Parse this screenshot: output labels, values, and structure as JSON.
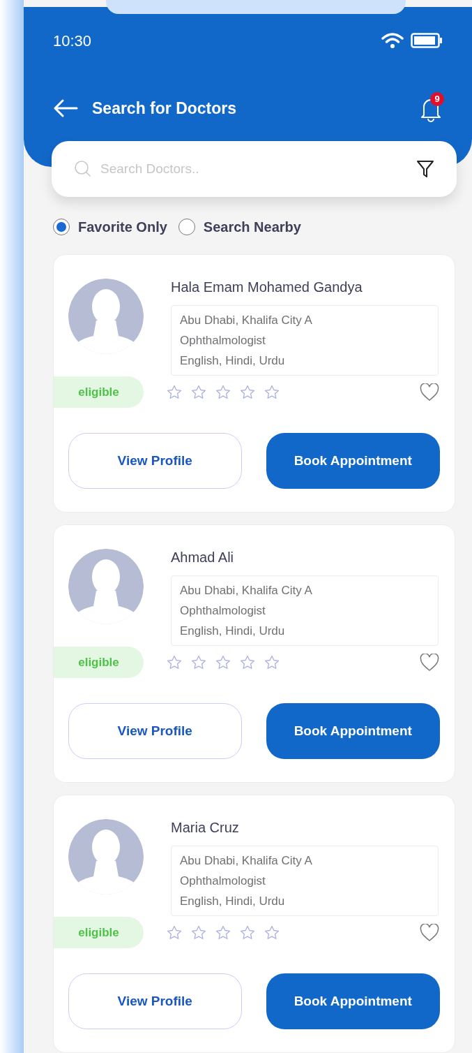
{
  "status_bar": {
    "time": "10:30"
  },
  "header": {
    "title": "Search for Doctors",
    "notification_count": "9"
  },
  "search": {
    "placeholder": "Search Doctors.."
  },
  "filters": [
    {
      "label": "Favorite Only",
      "selected": true
    },
    {
      "label": "Search Nearby",
      "selected": false
    }
  ],
  "doctors": [
    {
      "name": "Hala Emam Mohamed Gandya",
      "location": "Abu Dhabi, Khalifa City A",
      "specialty": "Ophthalmologist",
      "languages": "English, Hindi, Urdu",
      "badge": "eligible",
      "stars": 0,
      "favorite": false,
      "actions": [
        "View Profile",
        "Book Appointment"
      ]
    },
    {
      "name": "Ahmad Ali",
      "location": "Abu Dhabi, Khalifa City A",
      "specialty": "Ophthalmologist",
      "languages": "English, Hindi, Urdu",
      "badge": "eligible",
      "stars": 0,
      "favorite": false,
      "actions": [
        "View Profile",
        "Book Appointment"
      ]
    },
    {
      "name": "Maria Cruz",
      "location": "Abu Dhabi, Khalifa City A",
      "specialty": "Ophthalmologist",
      "languages": "English, Hindi, Urdu",
      "badge": "eligible",
      "stars": 0,
      "favorite": false,
      "actions": [
        "View Profile",
        "Book Appointment"
      ]
    }
  ]
}
